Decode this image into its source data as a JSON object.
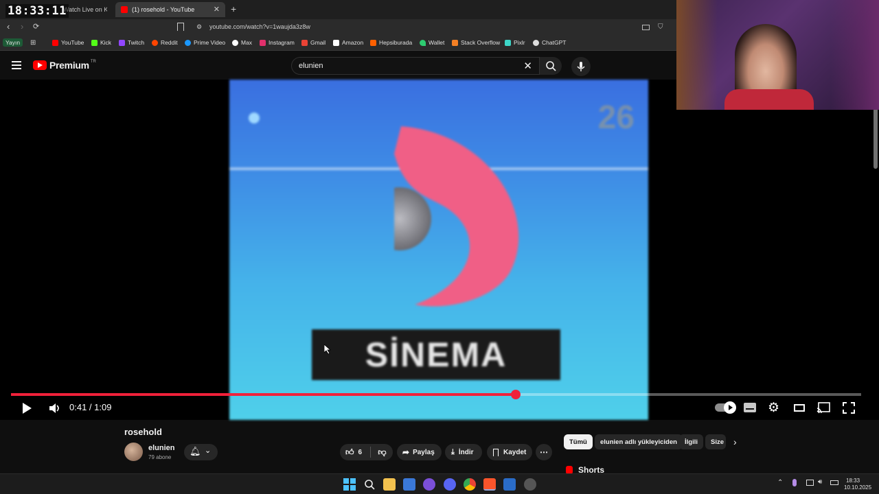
{
  "stream_overlay": {
    "clock": "18:33:11"
  },
  "browser": {
    "tabs": [
      {
        "label": "Watch Live on Ki",
        "active": false
      },
      {
        "label": "(1) rosehold - YouTube",
        "active": true
      }
    ],
    "url": "youtube.com/watch?v=1waujda3z8w",
    "bookmarks": [
      {
        "label": "Yayın",
        "icon": "badge"
      },
      {
        "label": "YouTube",
        "icon": "youtube-icon",
        "color": "#ff0000"
      },
      {
        "label": "Kick",
        "icon": "kick-icon",
        "color": "#53fc18"
      },
      {
        "label": "Twitch",
        "icon": "twitch-icon",
        "color": "#9146ff"
      },
      {
        "label": "Reddit",
        "icon": "reddit-icon",
        "color": "#ff4500"
      },
      {
        "label": "Prime Video",
        "icon": "prime-video-icon",
        "color": "#1a98ff"
      },
      {
        "label": "Max",
        "icon": "max-icon",
        "color": "#ffffff"
      },
      {
        "label": "Instagram",
        "icon": "instagram-icon",
        "color": "#e1306c"
      },
      {
        "label": "Gmail",
        "icon": "gmail-icon",
        "color": "#ea4335"
      },
      {
        "label": "Amazon",
        "icon": "amazon-icon",
        "color": "#ffffff"
      },
      {
        "label": "Hepsiburada",
        "icon": "hepsiburada-icon",
        "color": "#ff6000"
      },
      {
        "label": "Wallet",
        "icon": "wallet-icon",
        "color": "#2ecc71"
      },
      {
        "label": "Stack Overflow",
        "icon": "stackoverflow-icon",
        "color": "#f48024"
      },
      {
        "label": "Pixlr",
        "icon": "pixlr-icon",
        "color": "#3dd6c8"
      },
      {
        "label": "ChatGPT",
        "icon": "chatgpt-icon",
        "color": "#dddddd"
      }
    ]
  },
  "youtube": {
    "logo_text": "Premium",
    "logo_region": "TR",
    "search_value": "elunien",
    "player": {
      "current_time": "0:41",
      "duration": "1:09",
      "time_display": "0:41 / 1:09",
      "progress_fraction": 0.594
    },
    "video_frame_text": "SİNEMA",
    "video": {
      "title": "rosehold",
      "channel": "elunien",
      "subscribers": "79 abone",
      "likes": "6",
      "share_label": "Paylaş",
      "download_label": "İndir",
      "save_label": "Kaydet"
    },
    "chips": [
      {
        "label": "Tümü",
        "active": true
      },
      {
        "label": "elunien adlı yükleyiciden",
        "active": false
      },
      {
        "label": "İlgili",
        "active": false
      },
      {
        "label": "Size",
        "active": false
      }
    ],
    "shorts_label": "Shorts"
  },
  "taskbar": {
    "time": "18:33",
    "date": "10.10.2025"
  },
  "colors": {
    "yt_red": "#ff0000",
    "progress_red": "#f0213a",
    "background": "#0f0f0f"
  }
}
